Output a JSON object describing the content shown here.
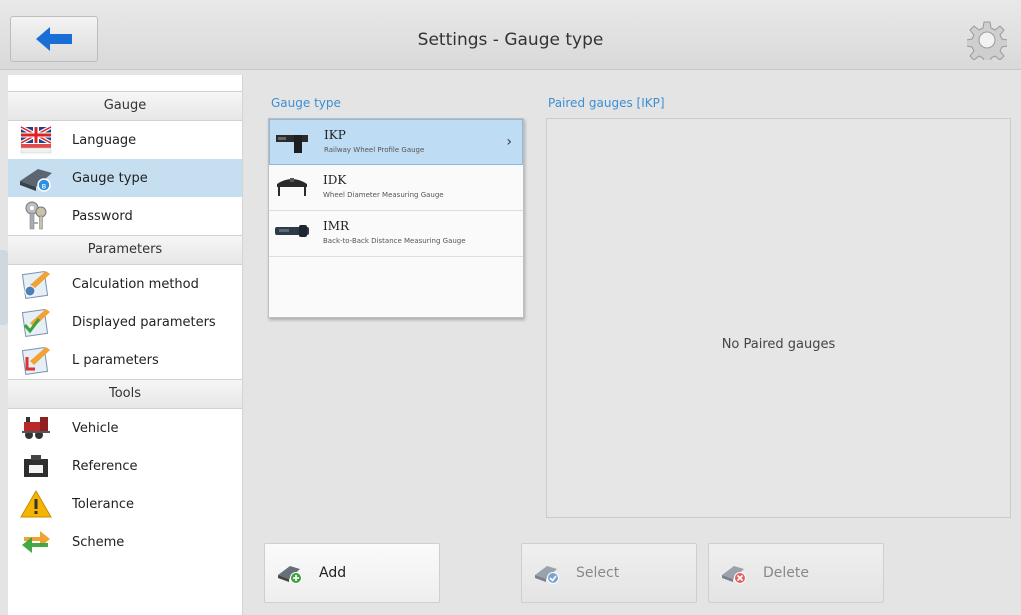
{
  "header": {
    "title": "Settings - Gauge type",
    "back_icon": "back-arrow-icon",
    "settings_icon": "gear-icon"
  },
  "sidebar": {
    "sections": [
      {
        "title": "Gauge",
        "items": [
          {
            "label": "Language",
            "icon": "uk-flag-icon",
            "active": false
          },
          {
            "label": "Gauge type",
            "icon": "gauge-device-icon",
            "active": true
          },
          {
            "label": "Password",
            "icon": "keys-icon",
            "active": false
          }
        ]
      },
      {
        "title": "Parameters",
        "items": [
          {
            "label": "Calculation method",
            "icon": "calc-checklist-icon",
            "active": false
          },
          {
            "label": "Displayed parameters",
            "icon": "checklist-icon",
            "active": false
          },
          {
            "label": "L parameters",
            "icon": "l-checklist-icon",
            "active": false
          }
        ]
      },
      {
        "title": "Tools",
        "items": [
          {
            "label": "Vehicle",
            "icon": "locomotive-icon",
            "active": false
          },
          {
            "label": "Reference",
            "icon": "reference-block-icon",
            "active": false
          },
          {
            "label": "Tolerance",
            "icon": "warning-icon",
            "active": false
          },
          {
            "label": "Scheme",
            "icon": "swap-arrows-icon",
            "active": false
          }
        ]
      }
    ]
  },
  "gauge_type": {
    "label": "Gauge type",
    "items": [
      {
        "name": "IKP",
        "description": "Railway Wheel Profile Gauge",
        "selected": true
      },
      {
        "name": "IDK",
        "description": "Wheel Diameter Measuring Gauge",
        "selected": false
      },
      {
        "name": "IMR",
        "description": "Back-to-Back Distance Measuring Gauge",
        "selected": false
      }
    ]
  },
  "paired": {
    "label": "Paired gauges [IKP]",
    "empty_text": "No Paired gauges"
  },
  "actions": {
    "add": "Add",
    "select": "Select",
    "delete": "Delete"
  },
  "colors": {
    "accent": "#3b8fd6",
    "selected_bg": "#c6dff0",
    "back_arrow": "#1a6fd6"
  }
}
